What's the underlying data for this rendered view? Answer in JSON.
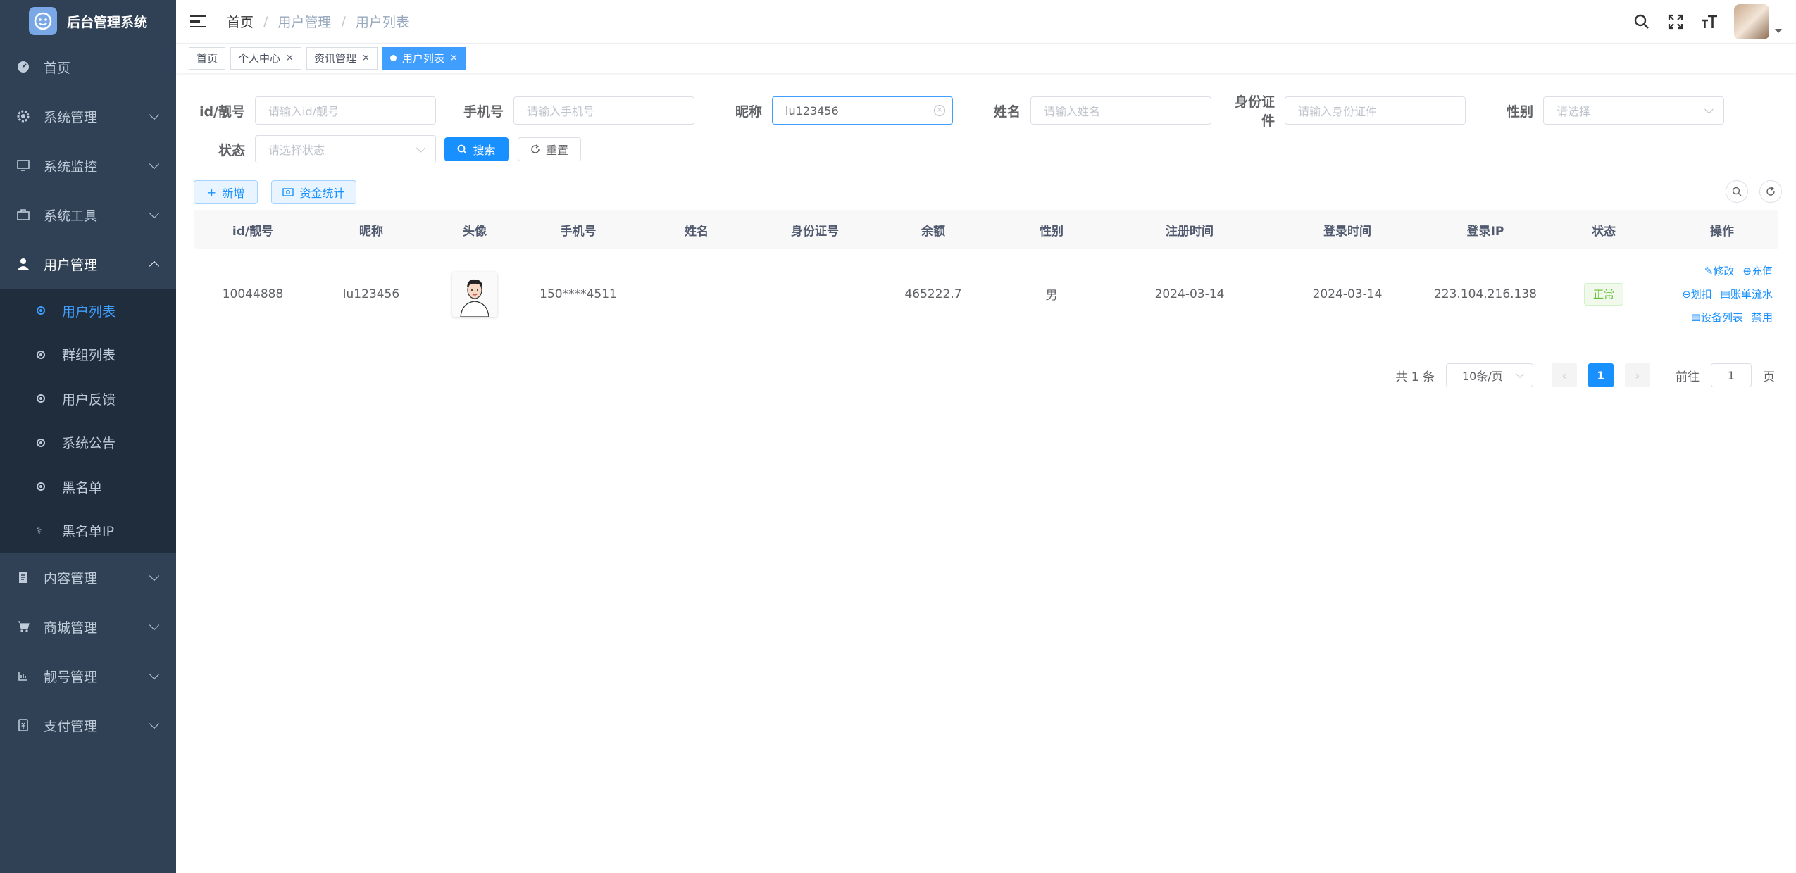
{
  "app": {
    "title": "后台管理系统"
  },
  "sidebar": {
    "items": [
      {
        "label": "首页"
      },
      {
        "label": "系统管理"
      },
      {
        "label": "系统监控"
      },
      {
        "label": "系统工具"
      },
      {
        "label": "用户管理"
      },
      {
        "label": "内容管理"
      },
      {
        "label": "商城管理"
      },
      {
        "label": "靓号管理"
      },
      {
        "label": "支付管理"
      }
    ],
    "user_submenu": [
      {
        "label": "用户列表"
      },
      {
        "label": "群组列表"
      },
      {
        "label": "用户反馈"
      },
      {
        "label": "系统公告"
      },
      {
        "label": "黑名单"
      },
      {
        "label": "黑名单IP"
      }
    ]
  },
  "breadcrumb": {
    "home": "首页",
    "section": "用户管理",
    "page": "用户列表"
  },
  "tags": [
    {
      "label": "首页"
    },
    {
      "label": "个人中心"
    },
    {
      "label": "资讯管理"
    },
    {
      "label": "用户列表"
    }
  ],
  "search": {
    "id_label": "id/靓号",
    "id_placeholder": "请输入id/靓号",
    "phone_label": "手机号",
    "phone_placeholder": "请输入手机号",
    "nickname_label": "昵称",
    "nickname_value": "lu123456",
    "name_label": "姓名",
    "name_placeholder": "请输入姓名",
    "idcard_label": "身份证件",
    "idcard_placeholder": "请输入身份证件",
    "gender_label": "性别",
    "gender_placeholder": "请选择",
    "status_label": "状态",
    "status_placeholder": "请选择状态",
    "search_btn": "搜索",
    "reset_btn": "重置"
  },
  "toolbar": {
    "add_btn": "新增",
    "funds_btn": "资金统计"
  },
  "table": {
    "headers": [
      "id/靓号",
      "昵称",
      "头像",
      "手机号",
      "姓名",
      "身份证号",
      "余额",
      "性别",
      "注册时间",
      "登录时间",
      "登录IP",
      "状态",
      "操作"
    ],
    "rows": [
      {
        "id": "10044888",
        "nickname": "lu123456",
        "phone": "150****4511",
        "name": "",
        "idcard": "",
        "balance": "465222.7",
        "gender": "男",
        "reg_time": "2024-03-14",
        "login_time": "2024-03-14",
        "login_ip": "223.104.216.138",
        "status": "正常",
        "ops": {
          "edit": "修改",
          "recharge": "充值",
          "deduct": "划扣",
          "bill": "账单流水",
          "devices": "设备列表",
          "disable": "禁用"
        }
      }
    ]
  },
  "pagination": {
    "total": "共 1 条",
    "page_size": "10条/页",
    "current": "1",
    "goto_label": "前往",
    "goto_value": "1",
    "page_suffix": "页"
  },
  "colors": {
    "primary": "#1890ff",
    "sidebar_bg": "#304156",
    "submenu_bg": "#1f2d3d",
    "success": "#67c23a"
  }
}
